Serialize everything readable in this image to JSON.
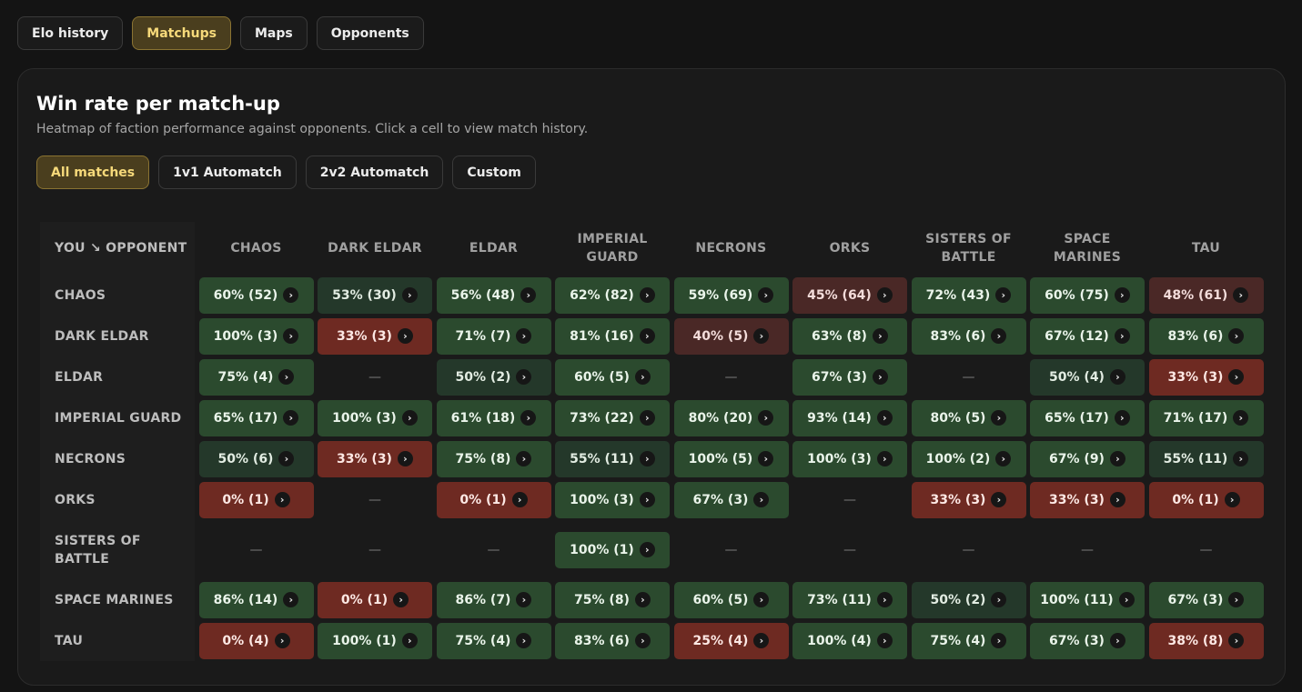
{
  "tabs": [
    {
      "label": "Elo history",
      "active": false
    },
    {
      "label": "Matchups",
      "active": true
    },
    {
      "label": "Maps",
      "active": false
    },
    {
      "label": "Opponents",
      "active": false
    }
  ],
  "panel": {
    "title": "Win rate per match-up",
    "subtitle": "Heatmap of faction performance against opponents. Click a cell to view match history."
  },
  "filters": [
    {
      "label": "All matches",
      "active": true
    },
    {
      "label": "1v1 Automatch",
      "active": false
    },
    {
      "label": "2v2 Automatch",
      "active": false
    },
    {
      "label": "Custom",
      "active": false
    }
  ],
  "chevron_glyph": "›",
  "empty_glyph": "—",
  "colors": {
    "strong_win": "#2b4a2e",
    "weak_win": "#24382a",
    "strong_loss": "#6e2a22",
    "weak_loss": "#4a2826",
    "accent": "#f6d97a"
  },
  "matrix": {
    "corner_label": "YOU ↘ OPPONENT",
    "columns": [
      "CHAOS",
      "DARK ELDAR",
      "ELDAR",
      "IMPERIAL GUARD",
      "NECRONS",
      "ORKS",
      "SISTERS OF BATTLE",
      "SPACE MARINES",
      "TAU"
    ],
    "rows": [
      {
        "label": "CHAOS",
        "cells": [
          "60% (52)",
          "53% (30)",
          "56% (48)",
          "62% (82)",
          "59% (69)",
          "45% (64)",
          "72% (43)",
          "60% (75)",
          "48% (61)"
        ]
      },
      {
        "label": "DARK ELDAR",
        "cells": [
          "100% (3)",
          "33% (3)",
          "71% (7)",
          "81% (16)",
          "40% (5)",
          "63% (8)",
          "83% (6)",
          "67% (12)",
          "83% (6)"
        ]
      },
      {
        "label": "ELDAR",
        "cells": [
          "75% (4)",
          null,
          "50% (2)",
          "60% (5)",
          null,
          "67% (3)",
          null,
          "50% (4)",
          "33% (3)"
        ]
      },
      {
        "label": "IMPERIAL GUARD",
        "cells": [
          "65% (17)",
          "100% (3)",
          "61% (18)",
          "73% (22)",
          "80% (20)",
          "93% (14)",
          "80% (5)",
          "65% (17)",
          "71% (17)"
        ]
      },
      {
        "label": "NECRONS",
        "cells": [
          "50% (6)",
          "33% (3)",
          "75% (8)",
          "55% (11)",
          "100% (5)",
          "100% (3)",
          "100% (2)",
          "67% (9)",
          "55% (11)"
        ]
      },
      {
        "label": "ORKS",
        "cells": [
          "0% (1)",
          null,
          "0% (1)",
          "100% (3)",
          "67% (3)",
          null,
          "33% (3)",
          "33% (3)",
          "0% (1)"
        ]
      },
      {
        "label": "SISTERS OF BATTLE",
        "cells": [
          null,
          null,
          null,
          "100% (1)",
          null,
          null,
          null,
          null,
          null
        ]
      },
      {
        "label": "SPACE MARINES",
        "cells": [
          "86% (14)",
          "0% (1)",
          "86% (7)",
          "75% (8)",
          "60% (5)",
          "73% (11)",
          "50% (2)",
          "100% (11)",
          "67% (3)"
        ]
      },
      {
        "label": "TAU",
        "cells": [
          "0% (4)",
          "100% (1)",
          "75% (4)",
          "83% (6)",
          "25% (4)",
          "100% (4)",
          "75% (4)",
          "67% (3)",
          "38% (8)"
        ]
      }
    ]
  }
}
